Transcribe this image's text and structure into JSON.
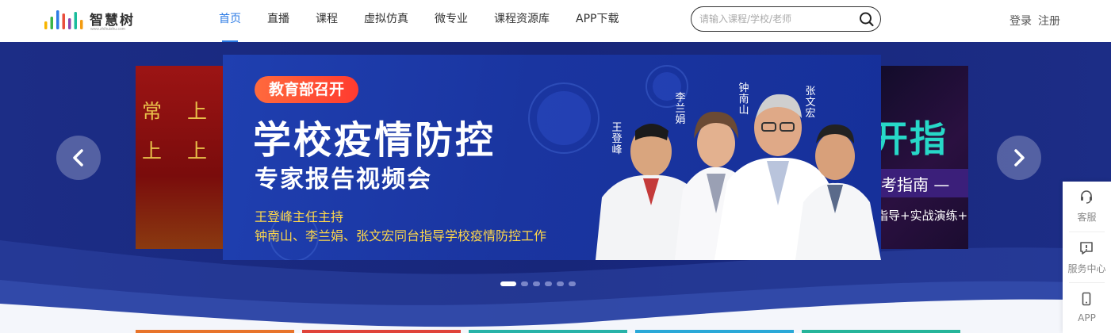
{
  "header": {
    "logo": {
      "name": "智慧树",
      "domain": "www.zhihuishu.com",
      "bar_colors": [
        "#f7b500",
        "#3ab54a",
        "#2c7be5",
        "#e94e3c",
        "#8e44ad",
        "#1abc9c",
        "#f39c12"
      ]
    },
    "nav": [
      {
        "label": "首页",
        "active": true
      },
      {
        "label": "直播",
        "active": false
      },
      {
        "label": "课程",
        "active": false
      },
      {
        "label": "虚拟仿真",
        "active": false
      },
      {
        "label": "微专业",
        "active": false
      },
      {
        "label": "课程资源库",
        "active": false
      },
      {
        "label": "APP下载",
        "active": false
      }
    ],
    "search": {
      "placeholder": "请输入课程/学校/老师",
      "value": ""
    },
    "auth": {
      "login": "登录",
      "register": "注册"
    }
  },
  "banner": {
    "left_slide": {
      "line1": "常 上 课",
      "line2": "上 上 课"
    },
    "main_slide": {
      "tag": "教育部召开",
      "title": "学校疫情防控",
      "subtitle": "专家报告视频会",
      "line1": "王登峰主任主持",
      "line2": "钟南山、李兰娟、张文宏同台指导学校疫情防控工作",
      "names": [
        "王登峰",
        "李兰娟",
        "钟南山",
        "张文宏"
      ]
    },
    "right_slide": {
      "headline": "开指",
      "band": "考指南  —",
      "small": "指导+实战演练+"
    },
    "dots": {
      "count": 6,
      "active_index": 0
    },
    "card_colors": [
      "#e8742a",
      "#e0433a",
      "#27b3a8",
      "#2aa9d8",
      "#26b59a"
    ]
  },
  "service_bar": {
    "items": [
      {
        "label": "客服",
        "icon": "headset-icon"
      },
      {
        "label": "服务中心",
        "icon": "message-alert-icon"
      },
      {
        "label": "APP",
        "icon": "phone-icon"
      }
    ]
  },
  "colors": {
    "accent": "#2c7be5",
    "banner_bg": "#1a2a7a",
    "tag": "#ff4a34",
    "highlight_text": "#ffd84a"
  }
}
